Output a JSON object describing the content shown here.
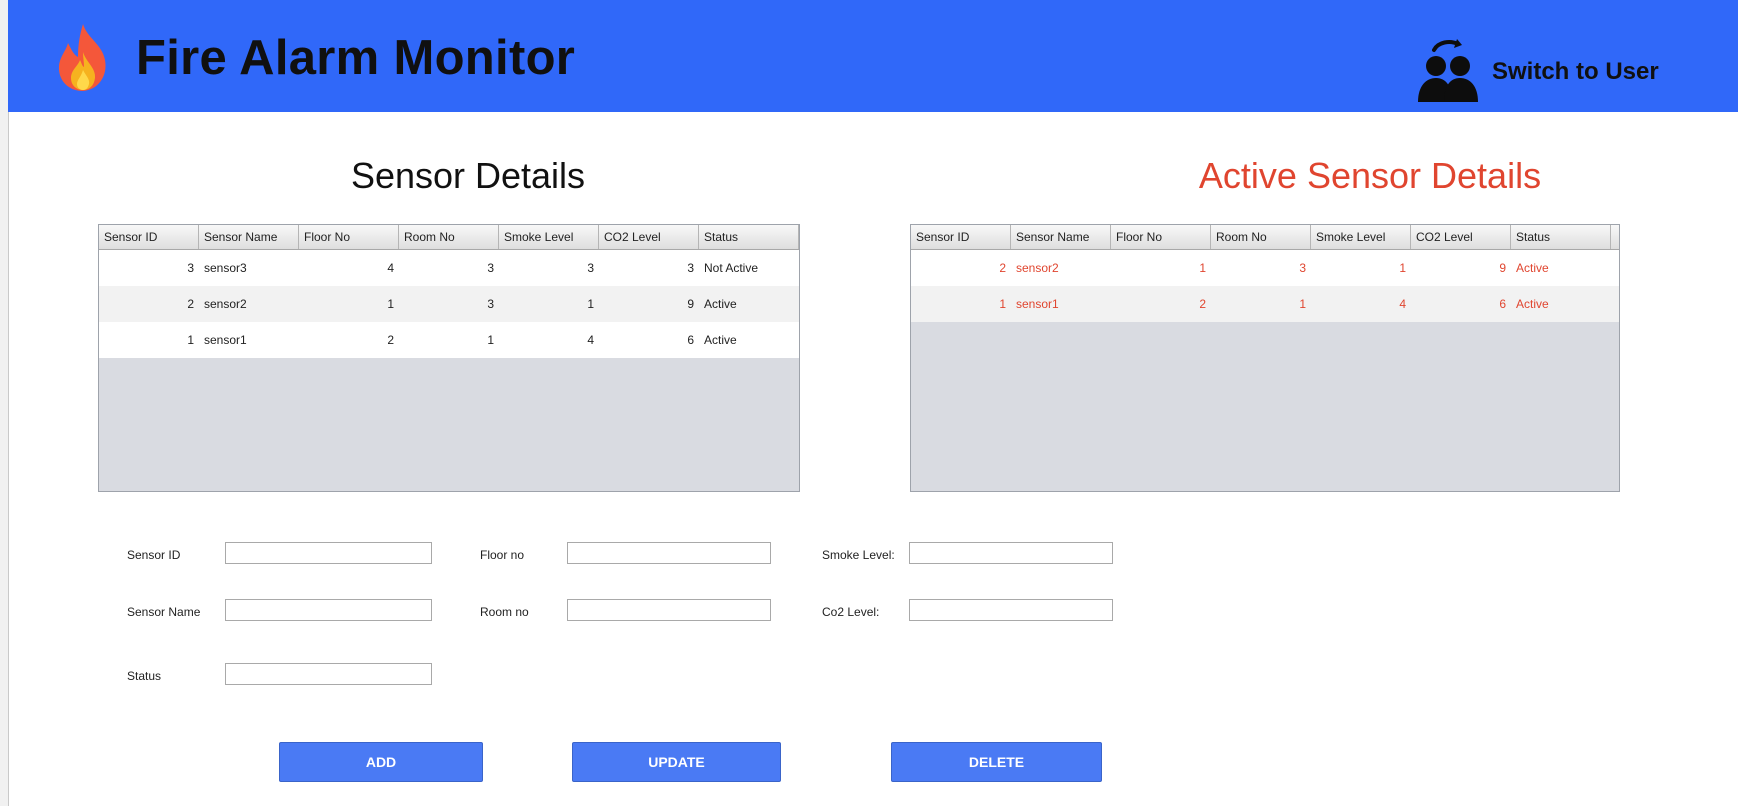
{
  "app": {
    "title": "Fire Alarm Monitor",
    "switch_label": "Switch to User"
  },
  "icons": {
    "logo": "fire-icon",
    "switch": "user-switch-icon"
  },
  "colors": {
    "header": "#3068f9",
    "active_accent": "#e0452f",
    "button": "#4a7af4"
  },
  "sensor_table": {
    "title": "Sensor Details",
    "columns": [
      "Sensor ID",
      "Sensor Name",
      "Floor No",
      "Room No",
      "Smoke Level",
      "CO2 Level",
      "Status"
    ],
    "rows": [
      [
        "3",
        "sensor3",
        "4",
        "3",
        "3",
        "3",
        "Not Active"
      ],
      [
        "2",
        "sensor2",
        "1",
        "3",
        "1",
        "9",
        "Active"
      ],
      [
        "1",
        "sensor1",
        "2",
        "1",
        "4",
        "6",
        "Active"
      ]
    ]
  },
  "active_table": {
    "title": "Active Sensor Details",
    "columns": [
      "Sensor ID",
      "Sensor Name",
      "Floor No",
      "Room No",
      "Smoke Level",
      "CO2 Level",
      "Status"
    ],
    "rows": [
      [
        "2",
        "sensor2",
        "1",
        "3",
        "1",
        "9",
        "Active"
      ],
      [
        "1",
        "sensor1",
        "2",
        "1",
        "4",
        "6",
        "Active"
      ]
    ]
  },
  "form": {
    "sensor_id": {
      "label": "Sensor ID",
      "value": ""
    },
    "sensor_name": {
      "label": "Sensor Name",
      "value": ""
    },
    "status": {
      "label": "Status",
      "value": ""
    },
    "floor_no": {
      "label": "Floor no",
      "value": ""
    },
    "room_no": {
      "label": "Room no",
      "value": ""
    },
    "smoke_level": {
      "label": "Smoke Level:",
      "value": ""
    },
    "co2_level": {
      "label": "Co2 Level:",
      "value": ""
    }
  },
  "buttons": {
    "add": "ADD",
    "update": "UPDATE",
    "delete": "DELETE"
  }
}
